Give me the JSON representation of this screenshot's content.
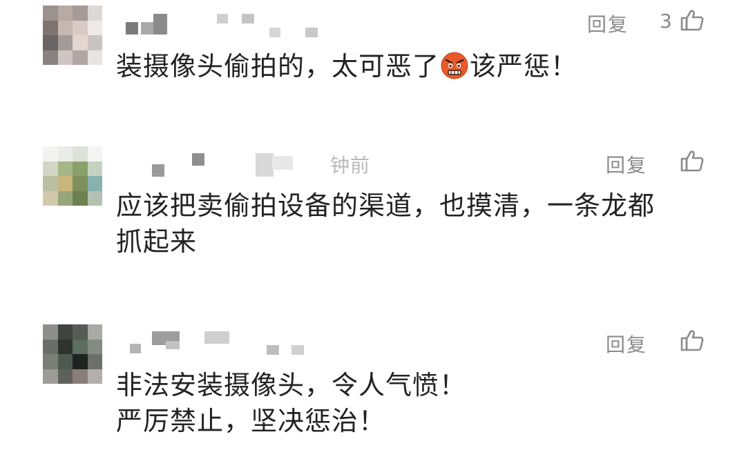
{
  "comments": [
    {
      "reply_label": "回复",
      "like_count": "3",
      "text_before_emoji": "装摄像头偷拍的，太可恶了",
      "emoji": "angry-face",
      "text_after_emoji": "该严惩！"
    },
    {
      "timestamp_partial": "钟前",
      "reply_label": "回复",
      "lines": [
        "应该把卖偷拍设备的渠道，也摸清，一条龙都",
        "抓起来"
      ]
    },
    {
      "reply_label": "回复",
      "lines": [
        "非法安装摄像头，令人气愤！",
        "严厉禁止，坚决惩治！"
      ]
    }
  ],
  "colors": {
    "text": "#222222",
    "meta": "#8a8a8a",
    "emoji_face": "#e85a2a"
  },
  "icons": {
    "like": "thumbs-up-outline-icon",
    "avatar": "pixelated-avatar",
    "name": "pixelated-username"
  }
}
